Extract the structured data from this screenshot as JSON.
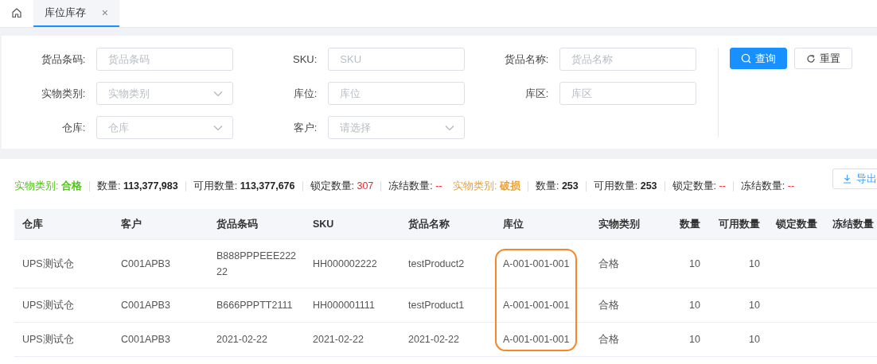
{
  "tabs": [
    {
      "kind": "home",
      "selected": false
    },
    {
      "kind": "page",
      "label": "库位库存",
      "close": "×",
      "selected": true
    }
  ],
  "filters": [
    {
      "label": "货品条码:",
      "placeholder": "货品条码",
      "kind": "input"
    },
    {
      "label": "SKU:",
      "placeholder": "SKU",
      "kind": "input"
    },
    {
      "label": "货品名称:",
      "placeholder": "货品名称",
      "kind": "input"
    },
    {
      "label": "实物类别:",
      "placeholder": "实物类别",
      "kind": "select"
    },
    {
      "label": "库位:",
      "placeholder": "库位",
      "kind": "input"
    },
    {
      "label": "库区:",
      "placeholder": "库区",
      "kind": "input"
    },
    {
      "label": "仓库:",
      "placeholder": "仓库",
      "kind": "select"
    },
    {
      "label": "客户:",
      "placeholder": "请选择",
      "kind": "select"
    }
  ],
  "buttons": [
    {
      "label": "查询",
      "kind": "primary"
    },
    {
      "label": "重置",
      "kind": "default"
    }
  ],
  "summary": [
    {
      "category_label": "实物类别:",
      "category": "合格",
      "color": "#52c41a",
      "stats": [
        {
          "label": "数量:",
          "value": "113,377,983",
          "kind": "bold"
        },
        {
          "label": "可用数量:",
          "value": "113,377,676",
          "kind": "bold"
        },
        {
          "label": "锁定数量:",
          "value": "307",
          "kind": "alert"
        },
        {
          "label": "冻结数量:",
          "value": "--",
          "kind": "alert"
        }
      ]
    },
    {
      "category_label": "实物类别:",
      "category": "破损",
      "color": "#e6a23c",
      "stats": [
        {
          "label": "数量:",
          "value": "253",
          "kind": "bold"
        },
        {
          "label": "可用数量:",
          "value": "253",
          "kind": "bold"
        },
        {
          "label": "锁定数量:",
          "value": "--",
          "kind": "alert"
        },
        {
          "label": "冻结数量:",
          "value": "--",
          "kind": "alert"
        }
      ]
    }
  ],
  "export_button": "导出",
  "table": {
    "columns": [
      {
        "label": "仓库",
        "numeric": false,
        "highlighted": false
      },
      {
        "label": "客户",
        "numeric": false,
        "highlighted": false
      },
      {
        "label": "货品条码",
        "numeric": false,
        "highlighted": false
      },
      {
        "label": "SKU",
        "numeric": false,
        "highlighted": false
      },
      {
        "label": "货品名称",
        "numeric": false,
        "highlighted": false
      },
      {
        "label": "库位",
        "numeric": false,
        "highlighted": true
      },
      {
        "label": "实物类别",
        "numeric": false,
        "highlighted": false
      },
      {
        "label": "数量",
        "numeric": true,
        "highlighted": false
      },
      {
        "label": "可用数量",
        "numeric": true,
        "highlighted": false
      },
      {
        "label": "锁定数量",
        "highlighted": false
      },
      {
        "label": "冻结数量",
        "highlighted": false
      }
    ],
    "rows": [
      [
        "UPS测试仓",
        "C001APB3",
        "B888PPPEEE22222",
        "HH000002222",
        "testProduct2",
        "A-001-001-001",
        "合格",
        "10",
        "10"
      ],
      [
        "UPS测试仓",
        "C001APB3",
        "B666PPPTT2111",
        "HH000001111",
        "testProduct1",
        "A-001-001-001",
        "合格",
        "10",
        "10"
      ],
      [
        "UPS测试仓",
        "C001APB3",
        "2021-02-22",
        "2021-02-22",
        "2021-02-22",
        "A-001-001-001",
        "合格",
        "10",
        "10"
      ]
    ]
  }
}
